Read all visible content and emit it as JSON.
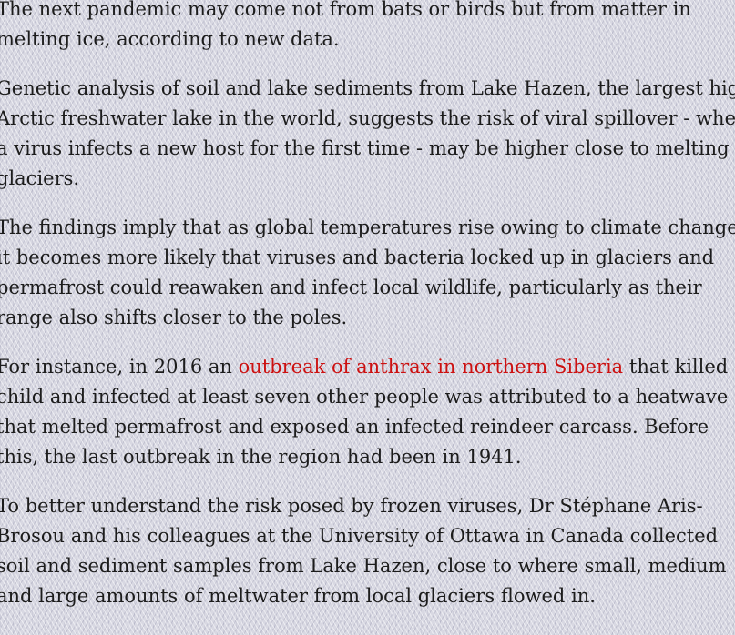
{
  "article": {
    "paragraphs": [
      {
        "lines": [
          "The next pandemic may come not from bats or birds but from matter in",
          "melting ice, according to new data."
        ]
      },
      {
        "lines": [
          "Genetic analysis of soil and lake sediments from Lake Hazen, the largest high",
          "Arctic freshwater lake in the world, suggests the risk of viral spillover - where",
          "a virus infects a new host for the first time - may be higher close to melting",
          "glaciers."
        ]
      },
      {
        "lines": [
          "The findings imply that as global temperatures rise owing to climate change,",
          "it becomes more likely that viruses and bacteria locked up in glaciers and",
          "permafrost could reawaken and infect local wildlife, particularly as their",
          "range also shifts closer to the poles."
        ]
      },
      {
        "line1_before": "For instance, in 2016 an ",
        "link_text": "outbreak of anthrax in northern Siberia",
        "line1_after": " that killed a",
        "lines": [
          "child and infected at least seven other people was attributed to a heatwave",
          "that melted permafrost and exposed an infected reindeer carcass. Before",
          "this, the last outbreak in the region had been in 1941."
        ]
      },
      {
        "lines": [
          "To better understand the risk posed by frozen viruses, Dr Stéphane Aris-",
          "Brosou and his colleagues at the University of Ottawa in Canada collected",
          "soil and sediment samples from Lake Hazen, close to where small, medium",
          "and large amounts of meltwater from local glaciers flowed in."
        ]
      }
    ]
  },
  "colors": {
    "link": "#cc1111",
    "text": "#1c1c1c"
  }
}
